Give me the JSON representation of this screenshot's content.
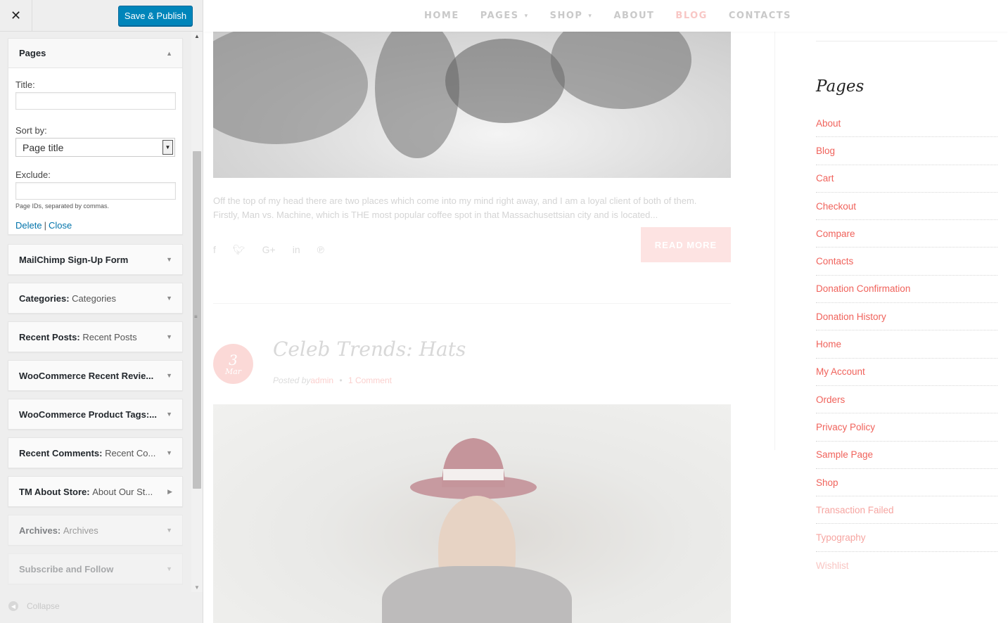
{
  "header": {
    "close_symbol": "✕",
    "save_label": "Save & Publish"
  },
  "pages_widget": {
    "title": "Pages",
    "title_label": "Title:",
    "title_value": "",
    "sort_label": "Sort by:",
    "sort_value": "Page title",
    "exclude_label": "Exclude:",
    "exclude_value": "",
    "exclude_hint": "Page IDs, separated by commas.",
    "delete_label": "Delete",
    "separator": "|",
    "close_label": "Close"
  },
  "widgets": [
    {
      "name": "MailChimp Sign-Up Form",
      "sub": ""
    },
    {
      "name": "Categories",
      "sub": "Categories"
    },
    {
      "name": "Recent Posts",
      "sub": "Recent Posts"
    },
    {
      "name": "WooCommerce Recent Revie...",
      "sub": ""
    },
    {
      "name": "WooCommerce Product Tags:...",
      "sub": ""
    },
    {
      "name": "Recent Comments",
      "sub": "Recent Co..."
    },
    {
      "name": "TM About Store",
      "sub": "About Our St..."
    },
    {
      "name": "Archives",
      "sub": "Archives"
    },
    {
      "name": "Subscribe and Follow",
      "sub": ""
    }
  ],
  "collapse_label": "Collapse",
  "nav": {
    "home": "HOME",
    "pages": "PAGES",
    "shop": "SHOP",
    "about": "ABOUT",
    "blog": "BLOG",
    "contacts": "CONTACTS"
  },
  "post1": {
    "excerpt": "Off the top of my head there are two places which come into my mind right away, and I am a loyal client of both of them. Firstly, Man vs. Machine, which is THE most popular coffee spot in that Massachusettsian city and is located...",
    "read_more": "READ MORE",
    "social_icons": [
      "facebook-icon",
      "twitter-icon",
      "google-plus-icon",
      "linkedin-icon",
      "pinterest-icon"
    ]
  },
  "post2": {
    "date_day": "3",
    "date_month": "Mar",
    "title": "Celeb Trends: Hats",
    "posted_by": "Posted by",
    "author": "admin",
    "bullet": "•",
    "comments": "1 Comment"
  },
  "right_sidebar": {
    "heading": "Pages",
    "links": [
      "About",
      "Blog",
      "Cart",
      "Checkout",
      "Compare",
      "Contacts",
      "Donation Confirmation",
      "Donation History",
      "Home",
      "My Account",
      "Orders",
      "Privacy Policy",
      "Sample Page",
      "Shop",
      "Transaction Failed",
      "Typography",
      "Wishlist"
    ]
  },
  "colors": {
    "accent_blue": "#0085ba",
    "link_pink": "#f0625b",
    "read_more_bg": "#fde3e2",
    "date_circle_bg": "#fbd9d7"
  }
}
